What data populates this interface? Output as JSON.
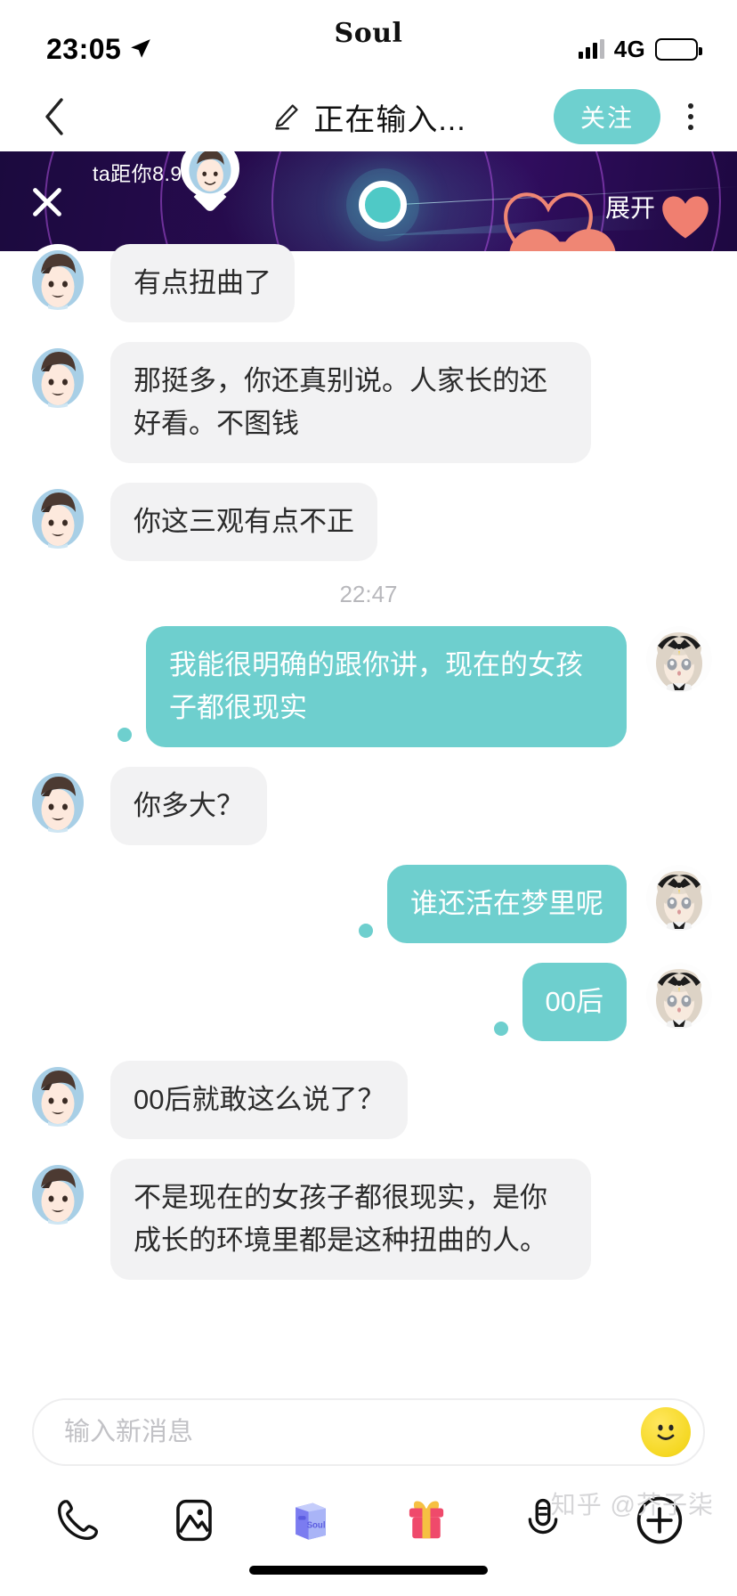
{
  "status_bar": {
    "time": "23:05",
    "location_icon": "location-arrow-icon",
    "app_name": "Soul",
    "network": "4G",
    "signal_icon": "signal-bars-icon",
    "battery_icon": "battery-full-icon"
  },
  "nav_bar": {
    "back_icon": "chevron-left-icon",
    "pencil_icon": "pencil-icon",
    "title": "正在输入...",
    "follow_label": "关注",
    "more_icon": "more-vertical-icon"
  },
  "banner": {
    "close_icon": "close-x-icon",
    "distance_text": "ta距你8.9km",
    "expand_label": "展开",
    "radar_icon": "radar-dot-icon",
    "pin_icon": "map-pin-avatar-icon",
    "heart_icon": "heart-icon",
    "bg_color": "#2a0b52",
    "accent_color": "#4fc9c6",
    "heart_color": "#ef8674"
  },
  "chat": {
    "accent_color": "#6ecfce",
    "incoming_bubble_color": "#f2f2f3",
    "messages": [
      {
        "side": "in",
        "text": "有点扭曲了"
      },
      {
        "side": "in",
        "text": "那挺多，你还真别说。人家长的还好看。不图钱"
      },
      {
        "side": "in",
        "text": "你这三观有点不正"
      },
      {
        "side": "time",
        "text": "22:47"
      },
      {
        "side": "out",
        "text": "我能很明确的跟你讲，现在的女孩子都很现实"
      },
      {
        "side": "in",
        "text": "你多大？"
      },
      {
        "side": "out",
        "text": "谁还活在梦里呢"
      },
      {
        "side": "out",
        "text": "00后"
      },
      {
        "side": "in",
        "text": "00后就敢这么说了？"
      },
      {
        "side": "in",
        "text": "不是现在的女孩子都很现实，是你成长的环境里都是这种扭曲的人。"
      }
    ]
  },
  "composer": {
    "placeholder": "输入新消息",
    "input_value": "",
    "emoji_icon": "smiley-face-icon",
    "tools": [
      {
        "name": "phone-icon",
        "label": "语音通话"
      },
      {
        "name": "image-icon",
        "label": "图片"
      },
      {
        "name": "soul-box-icon",
        "label": "Soul"
      },
      {
        "name": "gift-icon",
        "label": "礼物"
      },
      {
        "name": "microphone-icon",
        "label": "语音"
      },
      {
        "name": "plus-icon",
        "label": "更多"
      }
    ],
    "soul_box_text": "Soul"
  },
  "watermark": {
    "text": "知乎 @芥子柒"
  }
}
